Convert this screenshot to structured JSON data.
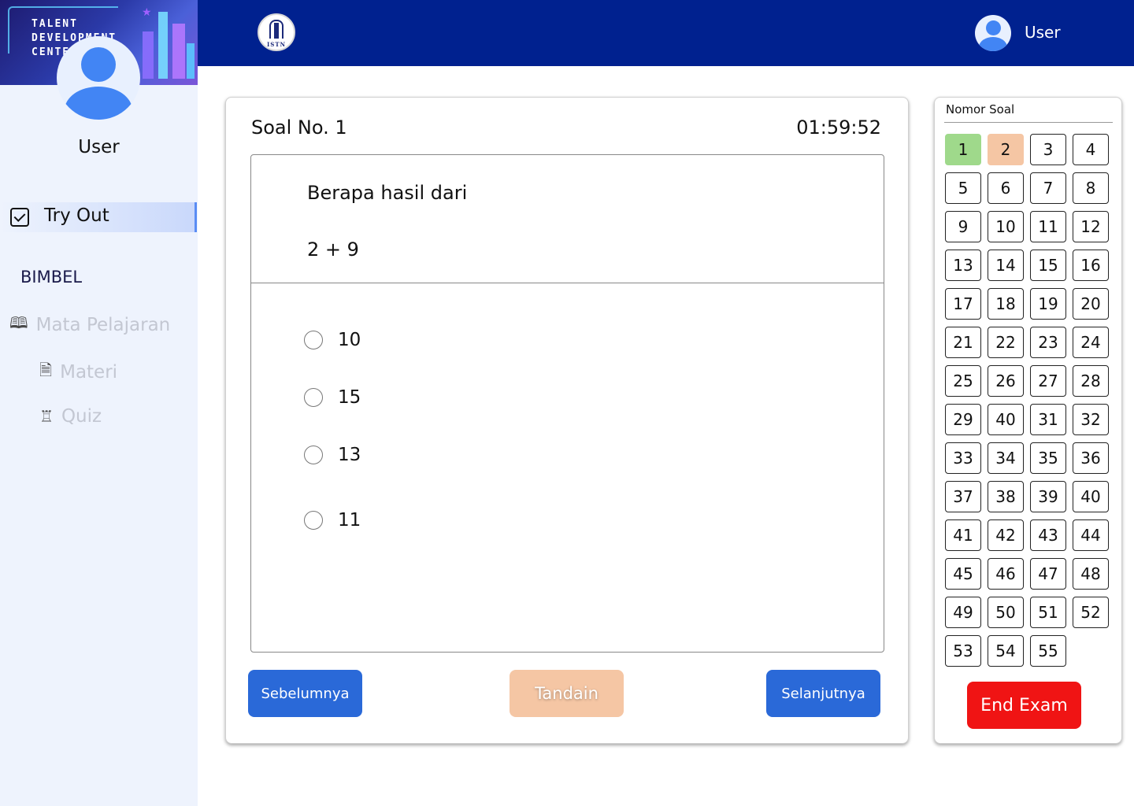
{
  "sidebar": {
    "banner_lines": [
      "TALENT",
      "DEVELOPMENT",
      "CENTER"
    ],
    "user_name": "User",
    "tryout_label": "Try Out",
    "section_label": "BIMBEL",
    "items": [
      {
        "label": "Mata Pelajaran",
        "icon": "book-icon"
      },
      {
        "label": "Materi",
        "icon": "document-icon"
      },
      {
        "label": "Quiz",
        "icon": "quiz-icon"
      }
    ]
  },
  "header": {
    "logo_text": "ISTN",
    "user_name": "User"
  },
  "question": {
    "title": "Soal No. 1",
    "timer": "01:59:52",
    "text": "Berapa hasil dari",
    "expression": "2 + 9",
    "options": [
      "10",
      "15",
      "13",
      "11"
    ]
  },
  "buttons": {
    "prev": "Sebelumnya",
    "mark": "Tandain",
    "next": "Selanjutnya",
    "end": "End Exam"
  },
  "number_panel": {
    "title": "Nomor Soal",
    "numbers": [
      "1",
      "2",
      "3",
      "4",
      "5",
      "6",
      "7",
      "8",
      "9",
      "10",
      "11",
      "12",
      "13",
      "14",
      "15",
      "16",
      "17",
      "18",
      "19",
      "20",
      "21",
      "22",
      "23",
      "24",
      "25",
      "26",
      "27",
      "28",
      "29",
      "40",
      "31",
      "32",
      "33",
      "34",
      "35",
      "36",
      "37",
      "38",
      "39",
      "40",
      "41",
      "42",
      "43",
      "44",
      "45",
      "46",
      "47",
      "48",
      "49",
      "50",
      "51",
      "52",
      "53",
      "54",
      "55"
    ],
    "answered": [
      "1"
    ],
    "marked": [
      "2"
    ]
  },
  "colors": {
    "topbar": "#00218f",
    "primary_button": "#2a69d8",
    "mark_button": "#f5c6a4",
    "end_button": "#f01414",
    "answered": "#9fd98b"
  }
}
